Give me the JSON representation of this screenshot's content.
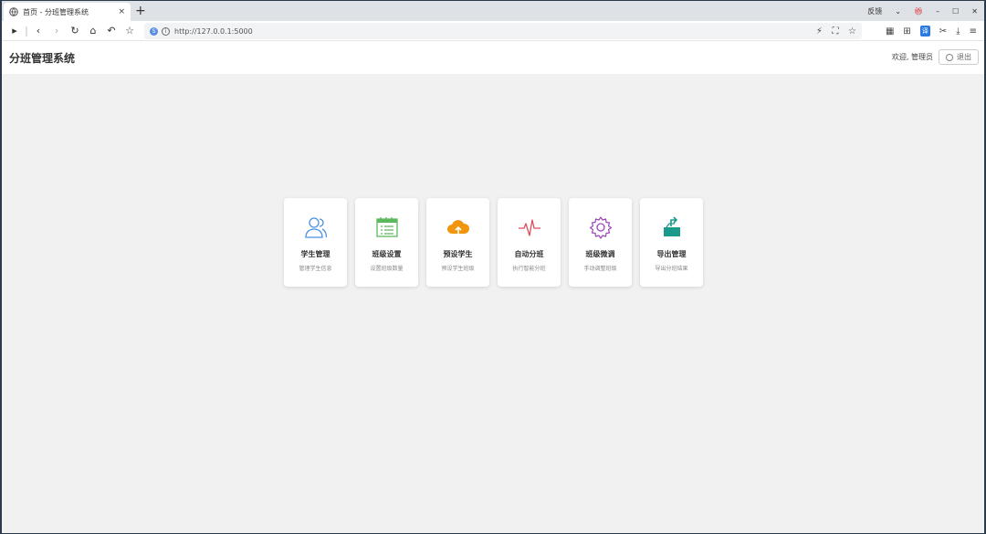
{
  "browser": {
    "tab_title": "首页 - 分班管理系统",
    "tab_close": "×",
    "new_tab": "+",
    "feedback": "反馈",
    "url": "http://127.0.0.1:5000"
  },
  "header": {
    "title": "分班管理系统",
    "welcome": "欢迎, 管理员",
    "logout": "退出"
  },
  "cards": [
    {
      "title": "学生管理",
      "subtitle": "管理学生信息",
      "icon": "users-icon",
      "color": "#4a90e2"
    },
    {
      "title": "班级设置",
      "subtitle": "设置班级数量",
      "icon": "calendar-icon",
      "color": "#5cb85c"
    },
    {
      "title": "预设学生",
      "subtitle": "预设学生班级",
      "icon": "cloud-upload-icon",
      "color": "#f0950c"
    },
    {
      "title": "自动分班",
      "subtitle": "执行智能分班",
      "icon": "pulse-icon",
      "color": "#e04b5a"
    },
    {
      "title": "班级微调",
      "subtitle": "手动调整班级",
      "icon": "gear-icon",
      "color": "#9b46b8"
    },
    {
      "title": "导出管理",
      "subtitle": "导出分班结果",
      "icon": "export-icon",
      "color": "#1a9a8a"
    }
  ]
}
